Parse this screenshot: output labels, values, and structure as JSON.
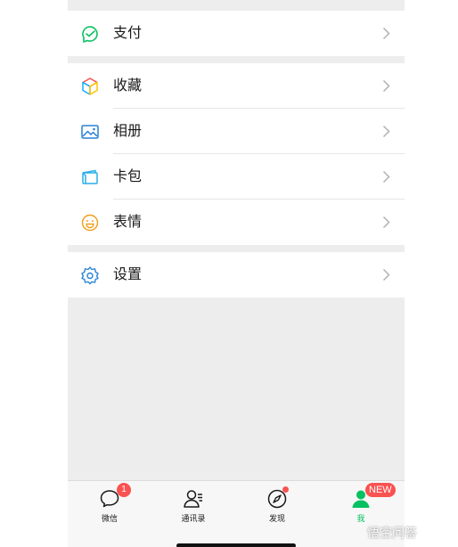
{
  "menu": {
    "pay": {
      "label": "支付",
      "icon": "wallet-pay-icon",
      "color": "#07c160"
    },
    "items": [
      {
        "label": "收藏",
        "icon": "favorites-cube-icon"
      },
      {
        "label": "相册",
        "icon": "album-picture-icon"
      },
      {
        "label": "卡包",
        "icon": "card-wallet-icon"
      },
      {
        "label": "表情",
        "icon": "sticker-smile-icon"
      }
    ],
    "settings": {
      "label": "设置",
      "icon": "gear-icon"
    }
  },
  "tabbar": {
    "tabs": [
      {
        "label": "微信",
        "icon": "chat-bubble-icon",
        "badge": "1"
      },
      {
        "label": "通讯录",
        "icon": "contacts-icon"
      },
      {
        "label": "发现",
        "icon": "compass-icon",
        "dot": true
      },
      {
        "label": "我",
        "icon": "me-person-icon",
        "badge": "NEW",
        "active": true
      }
    ]
  },
  "watermark": "悟空问答",
  "colors": {
    "accent": "#07c160",
    "badge": "#fa5151",
    "background": "#ededed"
  }
}
